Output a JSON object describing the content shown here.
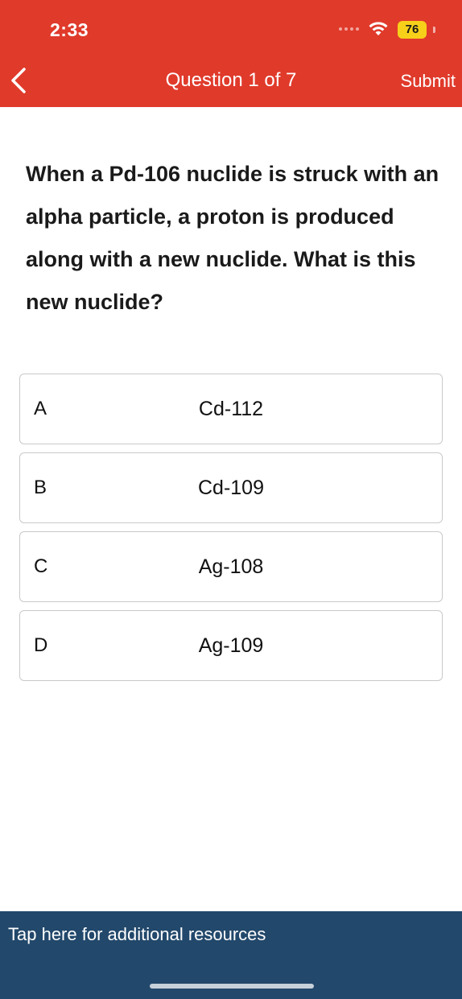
{
  "status_bar": {
    "time": "2:33",
    "battery": "76"
  },
  "header": {
    "title": "Question 1 of 7",
    "submit_label": "Submit",
    "background_color": "#e03a2b"
  },
  "question": {
    "text": "When a Pd-106 nuclide is struck with an alpha particle, a proton is produced along with a new nuclide. What is this new nuclide?"
  },
  "options": [
    {
      "letter": "A",
      "text": "Cd-112"
    },
    {
      "letter": "B",
      "text": "Cd-109"
    },
    {
      "letter": "C",
      "text": "Ag-108"
    },
    {
      "letter": "D",
      "text": "Ag-109"
    }
  ],
  "footer": {
    "text": "Tap here for additional resources",
    "background_color": "#22486b"
  }
}
